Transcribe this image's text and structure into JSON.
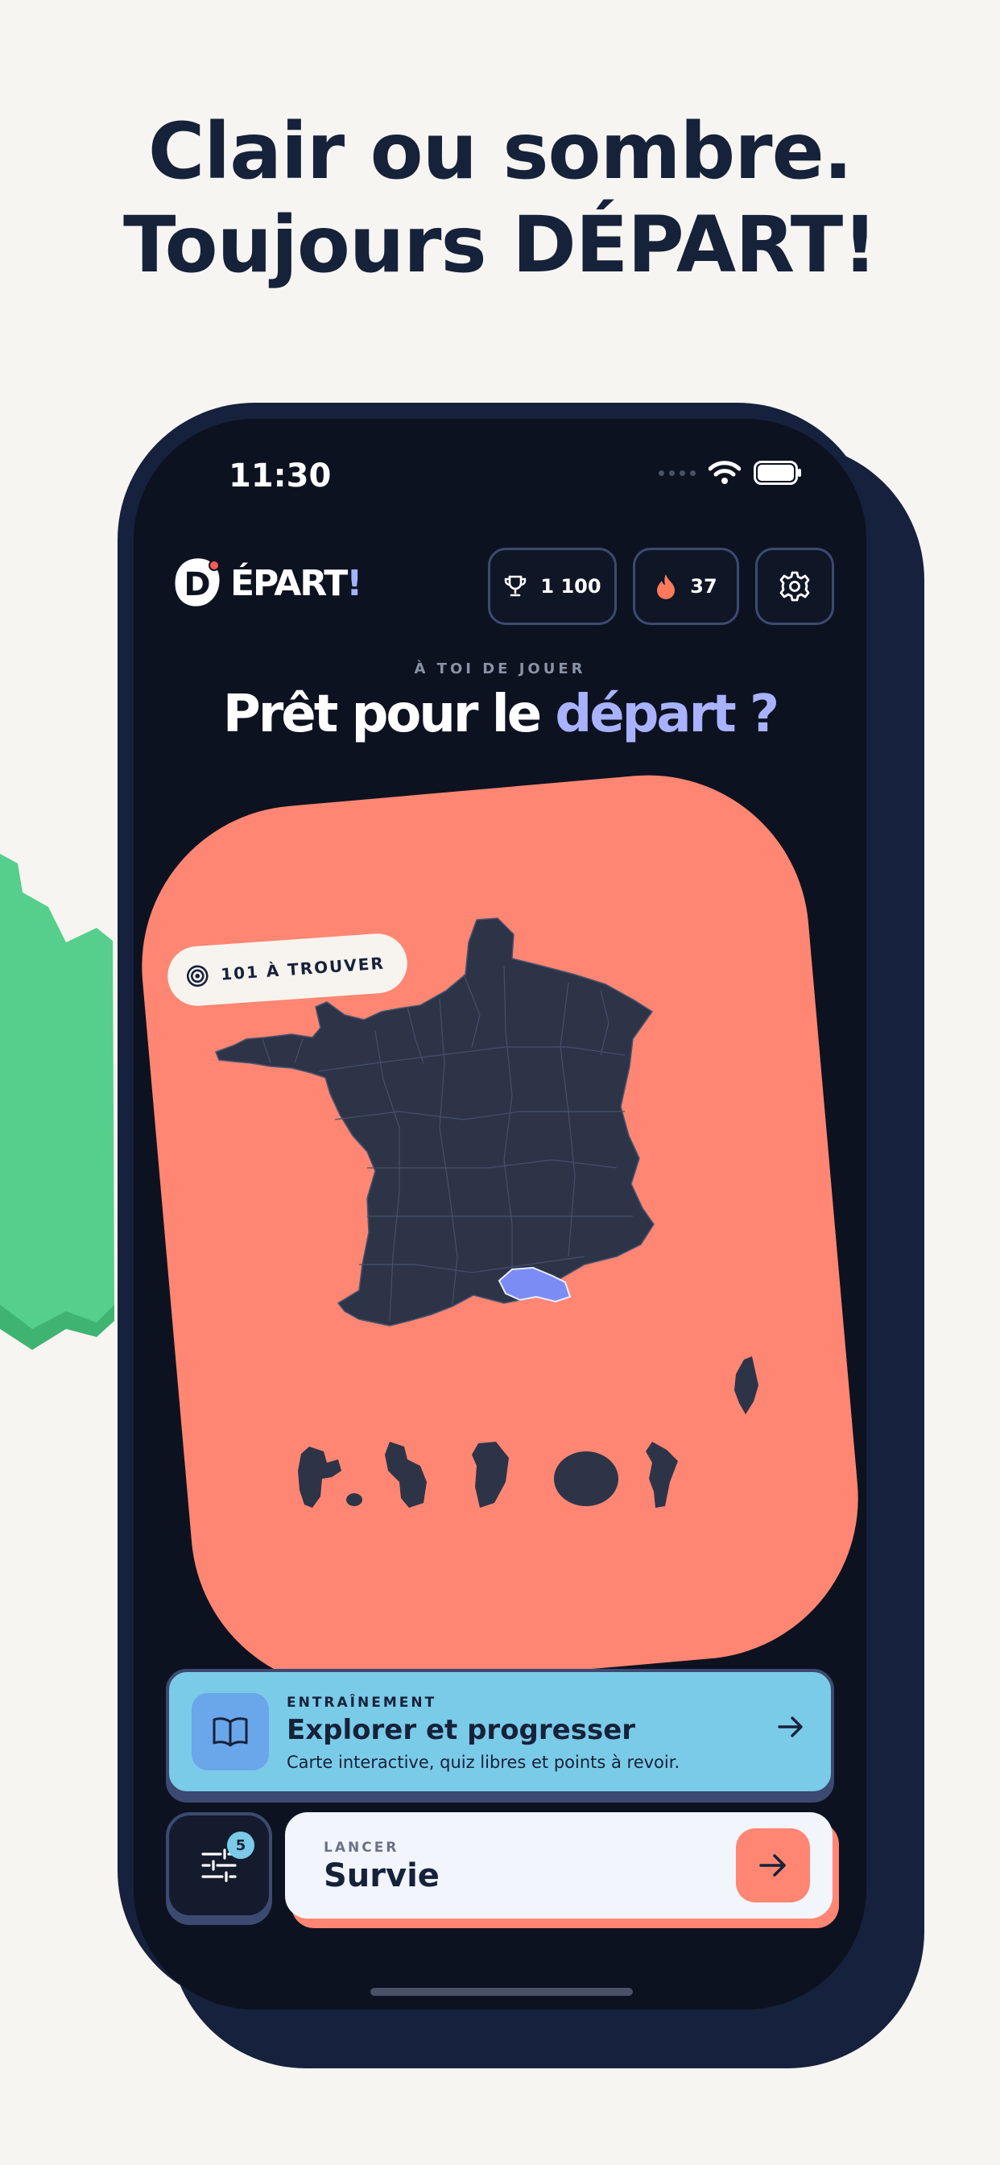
{
  "headline": {
    "line1": "Clair ou sombre.",
    "line2": "Toujours DÉPART!"
  },
  "status_bar": {
    "time": "11:30"
  },
  "app": {
    "logo_letter": "D",
    "logo_text": "ÉPART",
    "logo_bang": "!",
    "trophy_icon": "trophy-icon",
    "trophy_value": "1 100",
    "streak_icon": "flame-icon",
    "streak_value": "37",
    "settings_icon": "gear-icon"
  },
  "hero": {
    "eyebrow": "À TOI DE JOUER",
    "title_pre": "Prêt pour le ",
    "title_accent": "départ",
    "title_post": " ?"
  },
  "map": {
    "target_icon": "target-icon",
    "target_label": "101 À TROUVER",
    "highlighted_region": "Bouches-du-Rhône"
  },
  "training": {
    "eyebrow": "ENTRAÎNEMENT",
    "title": "Explorer et progresser",
    "subtitle": "Carte interactive, quiz libres et points à revoir.",
    "icon": "book-icon",
    "arrow_icon": "arrow-right-icon"
  },
  "filters": {
    "icon": "sliders-icon",
    "count": "5"
  },
  "launch": {
    "eyebrow": "LANCER",
    "title": "Survie",
    "arrow_icon": "arrow-right-icon"
  },
  "colors": {
    "background": "#f7f5f1",
    "headline": "#16213a",
    "phone": "#16213d",
    "screen": "#0d1220",
    "coral": "#ff8672",
    "map_fill": "#2d3448",
    "highlight": "#7b8cf5",
    "training_card": "#7acbe8",
    "accent_text": "#a8b2ff",
    "green_shape": "#55cf8b"
  }
}
